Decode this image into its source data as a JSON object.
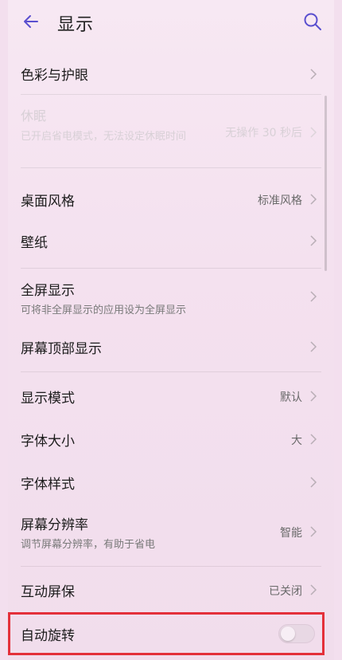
{
  "header": {
    "title": "显示"
  },
  "icons": {
    "back": "arrow-left-icon",
    "search": "search-icon",
    "chevron": "chevron-right-icon"
  },
  "colors": {
    "accent": "#5a4fcf",
    "highlight_border": "#e4303a"
  },
  "items": [
    {
      "label": "色彩与护眼"
    },
    {
      "label": "休眠",
      "sub": "已开启省电模式，无法设定休眠时间",
      "value": "无操作 30 秒后",
      "disabled": true
    },
    {
      "label": "桌面风格",
      "value": "标准风格"
    },
    {
      "label": "壁纸"
    },
    {
      "label": "全屏显示",
      "sub": "可将非全屏显示的应用设为全屏显示"
    },
    {
      "label": "屏幕顶部显示"
    },
    {
      "label": "显示模式",
      "value": "默认"
    },
    {
      "label": "字体大小",
      "value": "大"
    },
    {
      "label": "字体样式"
    },
    {
      "label": "屏幕分辨率",
      "sub": "调节屏幕分辨率，有助于省电",
      "value": "智能"
    },
    {
      "label": "互动屏保",
      "value": "已关闭"
    },
    {
      "label": "自动旋转",
      "toggle_on": false
    }
  ]
}
